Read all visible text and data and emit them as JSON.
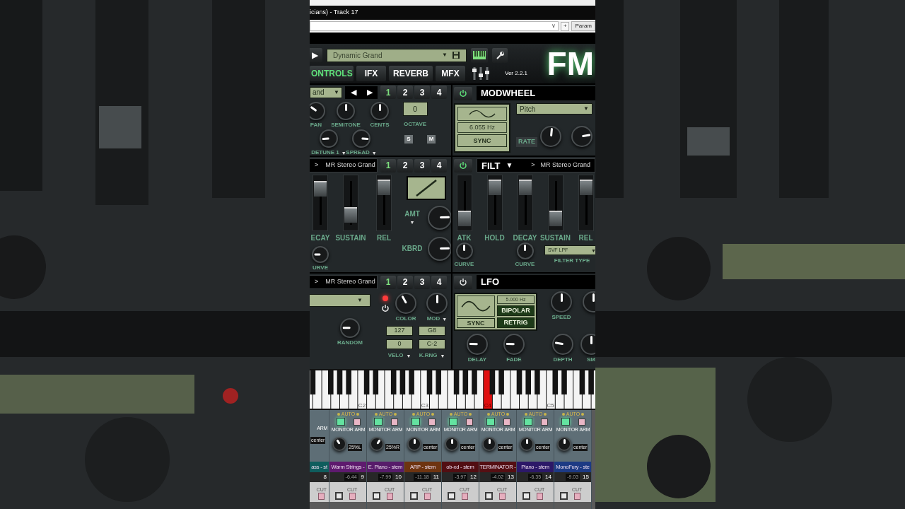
{
  "window": {
    "title": "icians) - Track 17"
  },
  "param_bar": {
    "menu_arrow": "∨",
    "add": "+",
    "param": "Param"
  },
  "header": {
    "play": "▶",
    "preset": "Dynamic Grand",
    "preset_arrow": "▼",
    "logo": "FM",
    "version": "Ver 2.2.1",
    "tabs": [
      {
        "label": "ONTROLS",
        "selected": true
      },
      {
        "label": "IFX",
        "selected": false
      },
      {
        "label": "REVERB",
        "selected": false
      },
      {
        "label": "MFX",
        "selected": false
      }
    ]
  },
  "oscillator": {
    "source": "and",
    "source_arrow": "▼",
    "prev": "◀",
    "next": "▶",
    "pages": [
      {
        "label": "1",
        "selected": true
      },
      {
        "label": "2",
        "selected": false
      },
      {
        "label": "3",
        "selected": false
      },
      {
        "label": "4",
        "selected": false
      }
    ],
    "knobs": [
      {
        "label": "PAN",
        "level": 0.3
      },
      {
        "label": "SEMITONE",
        "level": 0.5
      },
      {
        "label": "CENTS",
        "level": 0.5
      },
      {
        "label": "DETUNE 1",
        "arrow": "▼",
        "level": 0.15
      },
      {
        "label": "SPREAD",
        "arrow": "▼",
        "level": 0.85
      }
    ],
    "octave": "0",
    "octave_label": "OCTAVE",
    "solo": "S",
    "mute": "M"
  },
  "modwheel": {
    "on": true,
    "title": "MODWHEEL",
    "rate": "6.055 Hz",
    "sync": {
      "label": "SYNC",
      "on": false
    },
    "target": "Pitch",
    "target_arrow": "▼",
    "rate_label": "RATE",
    "knobs": [
      {
        "level": 0.52
      },
      {
        "level": 0.8
      }
    ]
  },
  "amp_env": {
    "source_mark": ">",
    "source": "MR Stereo Grand",
    "pages": [
      {
        "label": "1",
        "selected": true
      },
      {
        "label": "2",
        "selected": false
      },
      {
        "label": "3",
        "selected": false
      },
      {
        "label": "4",
        "selected": false
      }
    ],
    "sliders": [
      {
        "label": "ECAY",
        "level": 0.85
      },
      {
        "label": "SUSTAIN",
        "level": 0.2
      },
      {
        "label": "REL",
        "level": 0.9
      }
    ],
    "curve": {
      "label": "URVE",
      "level": 0.17
    },
    "knobs": [
      {
        "label": "AMT",
        "arrow": "▼",
        "level": 0.83
      },
      {
        "label": "KBRD",
        "level": 0.83
      }
    ]
  },
  "filter_env": {
    "on": true,
    "title": "FILT",
    "title_arrow": "▼",
    "source_mark": ">",
    "source": "MR Stereo Grand",
    "sliders": [
      {
        "label": "ATK",
        "level": 0.1
      },
      {
        "label": "HOLD",
        "level": 0.9
      },
      {
        "label": "DECAY",
        "level": 0.9
      },
      {
        "label": "SUSTAIN",
        "level": 0.1
      },
      {
        "label": "REL",
        "level": 0.9
      }
    ],
    "knobs": [
      {
        "label": "CURVE",
        "level": 0.5
      },
      {
        "label": "CURVE",
        "level": 0.5
      }
    ],
    "filter_type": "SVF LPF",
    "filter_arrow": "▼",
    "filter_type_label": "FILTER TYPE"
  },
  "random": {
    "source_mark": ">",
    "source": "MR Stereo Grand",
    "pages": [
      {
        "label": "1",
        "selected": true
      },
      {
        "label": "2",
        "selected": false
      },
      {
        "label": "3",
        "selected": false
      },
      {
        "label": "4",
        "selected": false
      }
    ],
    "dropdown_arrow": "▼",
    "led_on": true,
    "power_on": false,
    "knobs": [
      {
        "label": "COLOR",
        "level": 0.39
      },
      {
        "label": "MOD",
        "arrow": "▼",
        "level": 0.5
      },
      {
        "label": "RANDOM",
        "level": 0.17
      }
    ],
    "velo_high": "127",
    "velo_low": "0",
    "velo_label": "VELO",
    "velo_arrow": "▼",
    "key_high": "G8",
    "key_low": "C-2",
    "key_label": "K.RNG",
    "key_arrow": "▼"
  },
  "lfo": {
    "on": false,
    "title": "LFO",
    "rate": "5.000 Hz",
    "sync": {
      "label": "SYNC",
      "on": false
    },
    "bipolar": {
      "label": "BIPOLAR",
      "on": true
    },
    "retrig": {
      "label": "RETRIG",
      "on": true
    },
    "speed": {
      "label": "SPEED",
      "level": 0.5
    },
    "side_knob": {
      "level": 0.5
    },
    "knobs": [
      {
        "label": "DELAY",
        "level": 0.17
      },
      {
        "label": "FADE",
        "level": 0.17
      },
      {
        "label": "DEPTH",
        "level": 0.2
      },
      {
        "label": "SM",
        "level": 0.5
      }
    ]
  },
  "keyboard": {
    "c_keys": [
      {
        "label": "C2",
        "pressed": false
      },
      {
        "label": "C3",
        "pressed": false
      },
      {
        "label": "C4",
        "pressed": true
      },
      {
        "label": "C5",
        "pressed": false
      }
    ]
  },
  "channels": [
    {
      "kind": "partial",
      "arm": "ARM",
      "pan": "center",
      "name": "ass - st",
      "color": "#0f5d5d",
      "number": "8",
      "cut": "CUT"
    },
    {
      "kind": "full",
      "auto": "AUTO",
      "monitor": "MONITOR",
      "monitor_on": true,
      "arm": "ARM",
      "pan_knob": {
        "level": 0.38
      },
      "pan": "25%L",
      "name": "Warm Strings -",
      "color": "#5e1a6e",
      "volume": "-6.44",
      "number": "9",
      "cut": "CUT"
    },
    {
      "kind": "full",
      "auto": "AUTO",
      "monitor": "MONITOR",
      "monitor_on": true,
      "arm": "ARM",
      "pan_knob": {
        "level": 0.62
      },
      "pan": "25%R",
      "name": "E. Piano - stem",
      "color": "#571c6a",
      "volume": "-7.99",
      "number": "10",
      "cut": "CUT"
    },
    {
      "kind": "full",
      "auto": "AUTO",
      "monitor": "MONITOR",
      "monitor_on": true,
      "arm": "ARM",
      "pan_knob": {
        "level": 0.5
      },
      "pan": "center",
      "name": "ARP - stem",
      "color": "#6e3410",
      "volume": "-11.18",
      "number": "11",
      "cut": "CUT"
    },
    {
      "kind": "full",
      "auto": "AUTO",
      "monitor": "MONITOR",
      "monitor_on": true,
      "arm": "ARM",
      "pan_knob": {
        "level": 0.5
      },
      "pan": "center",
      "name": "ob-xd - stem",
      "color": "#520e12",
      "volume": "-3.97",
      "number": "12",
      "cut": "CUT"
    },
    {
      "kind": "full",
      "auto": "AUTO",
      "monitor": "MONITOR",
      "monitor_on": true,
      "arm": "ARM",
      "pan_knob": {
        "level": 0.5
      },
      "pan": "center",
      "name": "TERMINATOR -",
      "color": "#550f13",
      "volume": "-4.02",
      "number": "13",
      "cut": "CUT"
    },
    {
      "kind": "full",
      "auto": "AUTO",
      "monitor": "MONITOR",
      "monitor_on": true,
      "arm": "ARM",
      "pan_knob": {
        "level": 0.5
      },
      "pan": "center",
      "name": "Piano - stem",
      "color": "#2c1868",
      "volume": "-6.35",
      "number": "14",
      "cut": "CUT"
    },
    {
      "kind": "full",
      "auto": "AUTO",
      "monitor": "MONITOR",
      "monitor_on": true,
      "arm": "ARM",
      "pan_knob": {
        "level": 0.5
      },
      "pan": "center",
      "name": "MonoFury - ste",
      "color": "#1d3a84",
      "volume": "-9.03",
      "number": "15",
      "cut": "CUT"
    }
  ]
}
